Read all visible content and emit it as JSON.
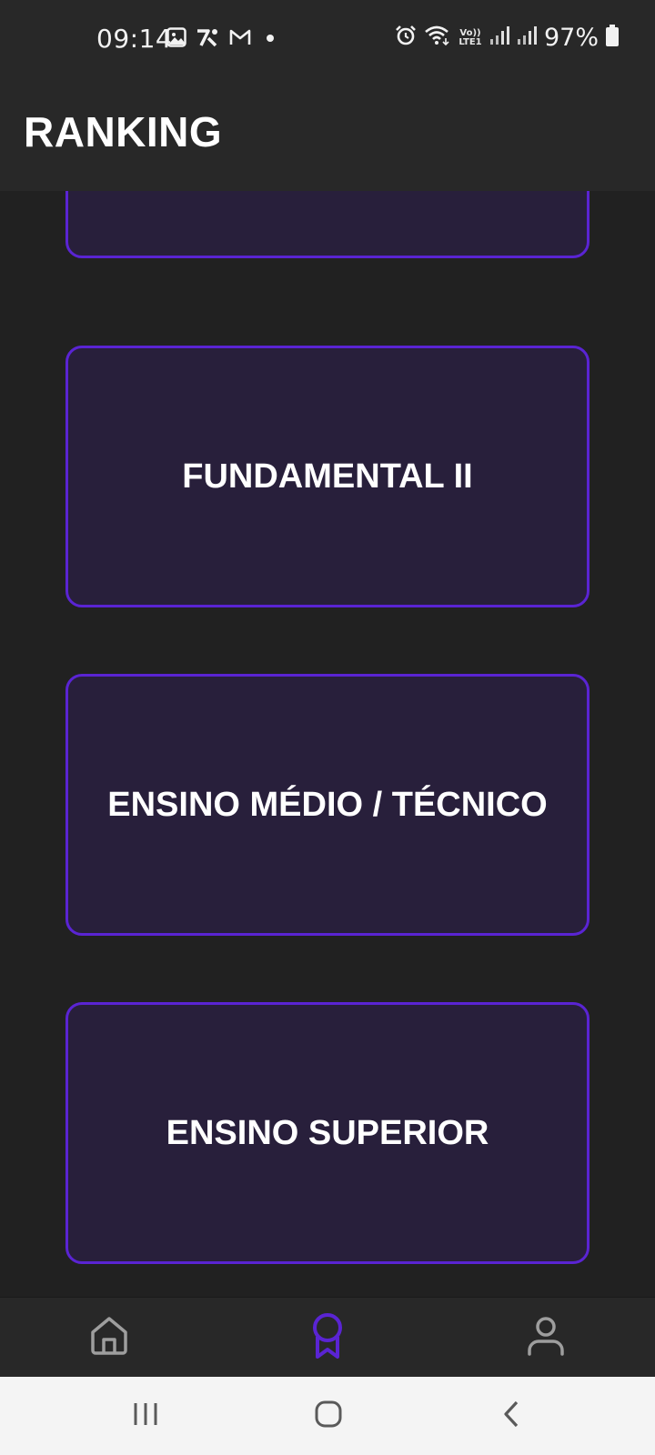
{
  "status_bar": {
    "time": "09:14",
    "battery_percent": "97%",
    "volte_top": "Vo))",
    "volte_bottom": "LTE1",
    "left_icons": [
      "gallery-icon",
      "app-notification-icon",
      "gmail-icon",
      "dot-icon"
    ],
    "right_icons": [
      "alarm-icon",
      "wifi-icon",
      "volte-icon",
      "signal-icon",
      "signal-icon",
      "battery-icon"
    ]
  },
  "app_bar": {
    "title": "RANKING"
  },
  "categories": [
    {
      "label": ""
    },
    {
      "label": "FUNDAMENTAL II"
    },
    {
      "label": "ENSINO MÉDIO / TÉCNICO"
    },
    {
      "label": "ENSINO SUPERIOR"
    }
  ],
  "bottom_nav": {
    "items": [
      {
        "icon": "home-icon",
        "active": false
      },
      {
        "icon": "ribbon-award-icon",
        "active": true
      },
      {
        "icon": "user-icon",
        "active": false
      }
    ],
    "active_color": "#5a24d3",
    "inactive_color": "#9e9e9e"
  },
  "system_nav": {
    "buttons": [
      "recent-apps-icon",
      "home-circle-icon",
      "back-icon"
    ]
  },
  "colors": {
    "background": "#212121",
    "bar": "#282828",
    "card_fill": "#281f3b",
    "card_border": "#5a24d3"
  }
}
